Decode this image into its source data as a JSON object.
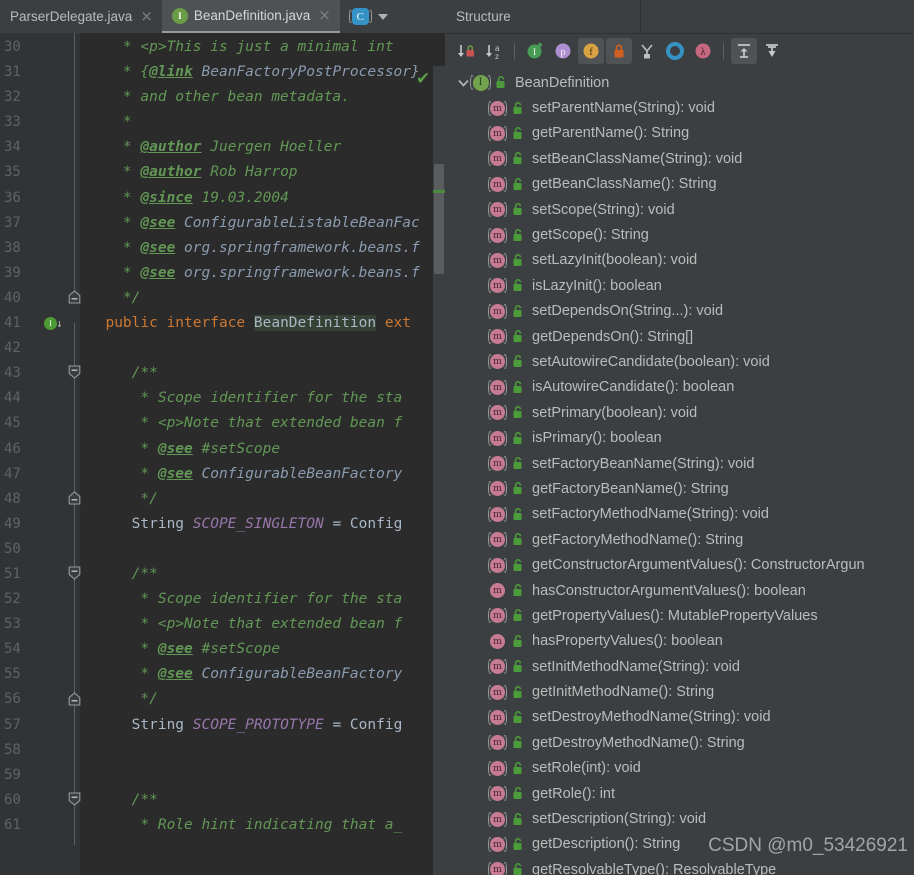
{
  "editor": {
    "tabs": [
      {
        "label": "ParserDelegate.java",
        "icon": "none",
        "active": false,
        "close": "×"
      },
      {
        "label": "BeanDefinition.java",
        "icon": "interface-icon",
        "active": true,
        "close": "×"
      }
    ],
    "tab_overflow_icon": "class-icon",
    "tab_overflow_letter": "C",
    "interface_letter": "I",
    "inspection_status_icon": "check-icon",
    "lines": [
      {
        "num": "30",
        "fold": "",
        "segments": [
          {
            "t": "    * ",
            "c": "cmt"
          },
          {
            "t": "<p>This is just a minimal int",
            "c": "cmt"
          }
        ]
      },
      {
        "num": "31",
        "fold": "",
        "segments": [
          {
            "t": "    * {",
            "c": "cmt"
          },
          {
            "t": "@link",
            "c": "cmt-tag"
          },
          {
            "t": " ",
            "c": "cmt"
          },
          {
            "t": "BeanFactoryPostProcessor}",
            "c": "cmt-ref"
          }
        ]
      },
      {
        "num": "32",
        "fold": "",
        "segments": [
          {
            "t": "    * and other bean metadata.",
            "c": "cmt"
          }
        ]
      },
      {
        "num": "33",
        "fold": "",
        "segments": [
          {
            "t": "    *",
            "c": "cmt"
          }
        ]
      },
      {
        "num": "34",
        "fold": "",
        "segments": [
          {
            "t": "    * ",
            "c": "cmt"
          },
          {
            "t": "@author",
            "c": "cmt-tag"
          },
          {
            "t": " Juergen Hoeller",
            "c": "cmt"
          }
        ]
      },
      {
        "num": "35",
        "fold": "",
        "segments": [
          {
            "t": "    * ",
            "c": "cmt"
          },
          {
            "t": "@author",
            "c": "cmt-tag"
          },
          {
            "t": " Rob Harrop",
            "c": "cmt"
          }
        ]
      },
      {
        "num": "36",
        "fold": "",
        "segments": [
          {
            "t": "    * ",
            "c": "cmt"
          },
          {
            "t": "@since",
            "c": "cmt-tag"
          },
          {
            "t": " 19.03.2004",
            "c": "cmt"
          }
        ]
      },
      {
        "num": "37",
        "fold": "",
        "segments": [
          {
            "t": "    * ",
            "c": "cmt"
          },
          {
            "t": "@see",
            "c": "cmt-tag"
          },
          {
            "t": " ",
            "c": "cmt"
          },
          {
            "t": "ConfigurableListableBeanFac",
            "c": "cmt-ref"
          }
        ]
      },
      {
        "num": "38",
        "fold": "",
        "segments": [
          {
            "t": "    * ",
            "c": "cmt"
          },
          {
            "t": "@see",
            "c": "cmt-tag"
          },
          {
            "t": " ",
            "c": "cmt"
          },
          {
            "t": "org.springframework.beans.f",
            "c": "cmt-ref"
          }
        ]
      },
      {
        "num": "39",
        "fold": "",
        "segments": [
          {
            "t": "    * ",
            "c": "cmt"
          },
          {
            "t": "@see",
            "c": "cmt-tag"
          },
          {
            "t": " ",
            "c": "cmt"
          },
          {
            "t": "org.springframework.beans.f",
            "c": "cmt-ref"
          }
        ]
      },
      {
        "num": "40",
        "fold": "end",
        "segments": [
          {
            "t": "    */",
            "c": "cmt"
          }
        ]
      },
      {
        "num": "41",
        "fold": "",
        "marker": "interface",
        "segments": [
          {
            "t": "  public interface ",
            "c": "kw"
          },
          {
            "t": "BeanDefinition",
            "c": "ident-hl"
          },
          {
            "t": " ",
            "c": "plain"
          },
          {
            "t": "ext",
            "c": "kw"
          }
        ]
      },
      {
        "num": "42",
        "fold": "",
        "segments": [
          {
            "t": "",
            "c": "plain"
          }
        ]
      },
      {
        "num": "43",
        "fold": "start",
        "segments": [
          {
            "t": "     /**",
            "c": "cmt"
          }
        ]
      },
      {
        "num": "44",
        "fold": "",
        "segments": [
          {
            "t": "      * Scope identifier for the sta",
            "c": "cmt"
          }
        ]
      },
      {
        "num": "45",
        "fold": "",
        "segments": [
          {
            "t": "      * <p>Note that extended bean f",
            "c": "cmt"
          }
        ]
      },
      {
        "num": "46",
        "fold": "",
        "segments": [
          {
            "t": "      * ",
            "c": "cmt"
          },
          {
            "t": "@see",
            "c": "cmt-tag"
          },
          {
            "t": " #setScope",
            "c": "cmt"
          }
        ]
      },
      {
        "num": "47",
        "fold": "",
        "segments": [
          {
            "t": "      * ",
            "c": "cmt"
          },
          {
            "t": "@see",
            "c": "cmt-tag"
          },
          {
            "t": " ",
            "c": "cmt"
          },
          {
            "t": "ConfigurableBeanFactory",
            "c": "cmt-ref"
          }
        ]
      },
      {
        "num": "48",
        "fold": "end",
        "segments": [
          {
            "t": "      */",
            "c": "cmt"
          }
        ]
      },
      {
        "num": "49",
        "fold": "",
        "segments": [
          {
            "t": "     String ",
            "c": "type"
          },
          {
            "t": "SCOPE_SINGLETON",
            "c": "const"
          },
          {
            "t": " = ",
            "c": "plain"
          },
          {
            "t": "Config",
            "c": "type"
          }
        ]
      },
      {
        "num": "50",
        "fold": "",
        "segments": [
          {
            "t": "",
            "c": "plain"
          }
        ]
      },
      {
        "num": "51",
        "fold": "start",
        "segments": [
          {
            "t": "     /**",
            "c": "cmt"
          }
        ]
      },
      {
        "num": "52",
        "fold": "",
        "segments": [
          {
            "t": "      * Scope identifier for the sta",
            "c": "cmt"
          }
        ]
      },
      {
        "num": "53",
        "fold": "",
        "segments": [
          {
            "t": "      * <p>Note that extended bean f",
            "c": "cmt"
          }
        ]
      },
      {
        "num": "54",
        "fold": "",
        "segments": [
          {
            "t": "      * ",
            "c": "cmt"
          },
          {
            "t": "@see",
            "c": "cmt-tag"
          },
          {
            "t": " #setScope",
            "c": "cmt"
          }
        ]
      },
      {
        "num": "55",
        "fold": "",
        "segments": [
          {
            "t": "      * ",
            "c": "cmt"
          },
          {
            "t": "@see",
            "c": "cmt-tag"
          },
          {
            "t": " ",
            "c": "cmt"
          },
          {
            "t": "ConfigurableBeanFactory",
            "c": "cmt-ref"
          }
        ]
      },
      {
        "num": "56",
        "fold": "end",
        "segments": [
          {
            "t": "      */",
            "c": "cmt"
          }
        ]
      },
      {
        "num": "57",
        "fold": "",
        "segments": [
          {
            "t": "     String ",
            "c": "type"
          },
          {
            "t": "SCOPE_PROTOTYPE",
            "c": "const"
          },
          {
            "t": " = ",
            "c": "plain"
          },
          {
            "t": "Config",
            "c": "type"
          }
        ]
      },
      {
        "num": "58",
        "fold": "",
        "segments": [
          {
            "t": "",
            "c": "plain"
          }
        ]
      },
      {
        "num": "59",
        "fold": "",
        "segments": [
          {
            "t": "",
            "c": "plain"
          }
        ]
      },
      {
        "num": "60",
        "fold": "start",
        "segments": [
          {
            "t": "     /**",
            "c": "cmt"
          }
        ]
      },
      {
        "num": "61",
        "fold": "",
        "segments": [
          {
            "t": "      * Role hint indicating that a_",
            "c": "cmt"
          }
        ]
      }
    ]
  },
  "structure": {
    "title": "Structure",
    "toolbar": [
      {
        "name": "sort-by-visibility-button",
        "icon": "arrow-down-lock-icon",
        "pressed": false
      },
      {
        "name": "sort-alphabetically-button",
        "icon": "arrow-down-az-icon",
        "pressed": false
      },
      {
        "name": "show-inherited-button",
        "icon": "inherited-interface-icon",
        "pressed": false
      },
      {
        "name": "show-properties-button",
        "icon": "property-icon",
        "pressed": false
      },
      {
        "name": "show-fields-button",
        "icon": "field-icon",
        "pressed": true
      },
      {
        "name": "show-non-public-button",
        "icon": "lock-icon",
        "pressed": true
      },
      {
        "name": "group-by-implementation-button",
        "icon": "hierarchy-icon",
        "pressed": false
      },
      {
        "name": "show-anonymous-classes-button",
        "icon": "circle-icon",
        "pressed": false
      },
      {
        "name": "show-lambdas-button",
        "icon": "lambda-icon",
        "pressed": false
      },
      {
        "name": "expand-all-button",
        "icon": "expand-all-icon",
        "pressed": true
      },
      {
        "name": "collapse-all-button",
        "icon": "collapse-all-icon",
        "pressed": false
      }
    ],
    "root": {
      "label": "BeanDefinition",
      "icon": "interface-icon",
      "letter": "I",
      "expanded": true,
      "access_icon": "unlocked-green-icon"
    },
    "members": [
      {
        "label": "setParentName(String): void",
        "kind": "abstract",
        "letter": "m",
        "access_icon": "unlocked-green-icon"
      },
      {
        "label": "getParentName(): String",
        "kind": "abstract",
        "letter": "m",
        "access_icon": "unlocked-green-icon"
      },
      {
        "label": "setBeanClassName(String): void",
        "kind": "abstract",
        "letter": "m",
        "access_icon": "unlocked-green-icon"
      },
      {
        "label": "getBeanClassName(): String",
        "kind": "abstract",
        "letter": "m",
        "access_icon": "unlocked-green-icon"
      },
      {
        "label": "setScope(String): void",
        "kind": "abstract",
        "letter": "m",
        "access_icon": "unlocked-green-icon"
      },
      {
        "label": "getScope(): String",
        "kind": "abstract",
        "letter": "m",
        "access_icon": "unlocked-green-icon"
      },
      {
        "label": "setLazyInit(boolean): void",
        "kind": "abstract",
        "letter": "m",
        "access_icon": "unlocked-green-icon"
      },
      {
        "label": "isLazyInit(): boolean",
        "kind": "abstract",
        "letter": "m",
        "access_icon": "unlocked-green-icon"
      },
      {
        "label": "setDependsOn(String...): void",
        "kind": "abstract",
        "letter": "m",
        "access_icon": "unlocked-green-icon"
      },
      {
        "label": "getDependsOn(): String[]",
        "kind": "abstract",
        "letter": "m",
        "access_icon": "unlocked-green-icon"
      },
      {
        "label": "setAutowireCandidate(boolean): void",
        "kind": "abstract",
        "letter": "m",
        "access_icon": "unlocked-green-icon"
      },
      {
        "label": "isAutowireCandidate(): boolean",
        "kind": "abstract",
        "letter": "m",
        "access_icon": "unlocked-green-icon"
      },
      {
        "label": "setPrimary(boolean): void",
        "kind": "abstract",
        "letter": "m",
        "access_icon": "unlocked-green-icon"
      },
      {
        "label": "isPrimary(): boolean",
        "kind": "abstract",
        "letter": "m",
        "access_icon": "unlocked-green-icon"
      },
      {
        "label": "setFactoryBeanName(String): void",
        "kind": "abstract",
        "letter": "m",
        "access_icon": "unlocked-green-icon"
      },
      {
        "label": "getFactoryBeanName(): String",
        "kind": "abstract",
        "letter": "m",
        "access_icon": "unlocked-green-icon"
      },
      {
        "label": "setFactoryMethodName(String): void",
        "kind": "abstract",
        "letter": "m",
        "access_icon": "unlocked-green-icon"
      },
      {
        "label": "getFactoryMethodName(): String",
        "kind": "abstract",
        "letter": "m",
        "access_icon": "unlocked-green-icon"
      },
      {
        "label": "getConstructorArgumentValues(): ConstructorArgun",
        "kind": "abstract",
        "letter": "m",
        "access_icon": "unlocked-green-icon"
      },
      {
        "label": "hasConstructorArgumentValues(): boolean",
        "kind": "default",
        "letter": "m",
        "access_icon": "unlocked-green-icon"
      },
      {
        "label": "getPropertyValues(): MutablePropertyValues",
        "kind": "abstract",
        "letter": "m",
        "access_icon": "unlocked-green-icon"
      },
      {
        "label": "hasPropertyValues(): boolean",
        "kind": "default",
        "letter": "m",
        "access_icon": "unlocked-green-icon"
      },
      {
        "label": "setInitMethodName(String): void",
        "kind": "abstract",
        "letter": "m",
        "access_icon": "unlocked-green-icon"
      },
      {
        "label": "getInitMethodName(): String",
        "kind": "abstract",
        "letter": "m",
        "access_icon": "unlocked-green-icon"
      },
      {
        "label": "setDestroyMethodName(String): void",
        "kind": "abstract",
        "letter": "m",
        "access_icon": "unlocked-green-icon"
      },
      {
        "label": "getDestroyMethodName(): String",
        "kind": "abstract",
        "letter": "m",
        "access_icon": "unlocked-green-icon"
      },
      {
        "label": "setRole(int): void",
        "kind": "abstract",
        "letter": "m",
        "access_icon": "unlocked-green-icon"
      },
      {
        "label": "getRole(): int",
        "kind": "abstract",
        "letter": "m",
        "access_icon": "unlocked-green-icon"
      },
      {
        "label": "setDescription(String): void",
        "kind": "abstract",
        "letter": "m",
        "access_icon": "unlocked-green-icon"
      },
      {
        "label": "getDescription(): String",
        "kind": "abstract",
        "letter": "m",
        "access_icon": "unlocked-green-icon"
      },
      {
        "label": "getResolvableType(): ResolvableType",
        "kind": "abstract",
        "letter": "m",
        "access_icon": "unlocked-green-icon"
      }
    ]
  },
  "watermark": "CSDN @m0_53426921",
  "colors": {
    "editor_bg": "#2b2b2b",
    "gutter_bg": "#313335",
    "panel_bg": "#3c3f41",
    "comment_green": "#629755",
    "keyword_orange": "#cc7832",
    "constant_purple": "#9876aa",
    "method_pink": "#c77b93",
    "interface_green": "#72a24d",
    "text_gray": "#bbbbbb"
  }
}
